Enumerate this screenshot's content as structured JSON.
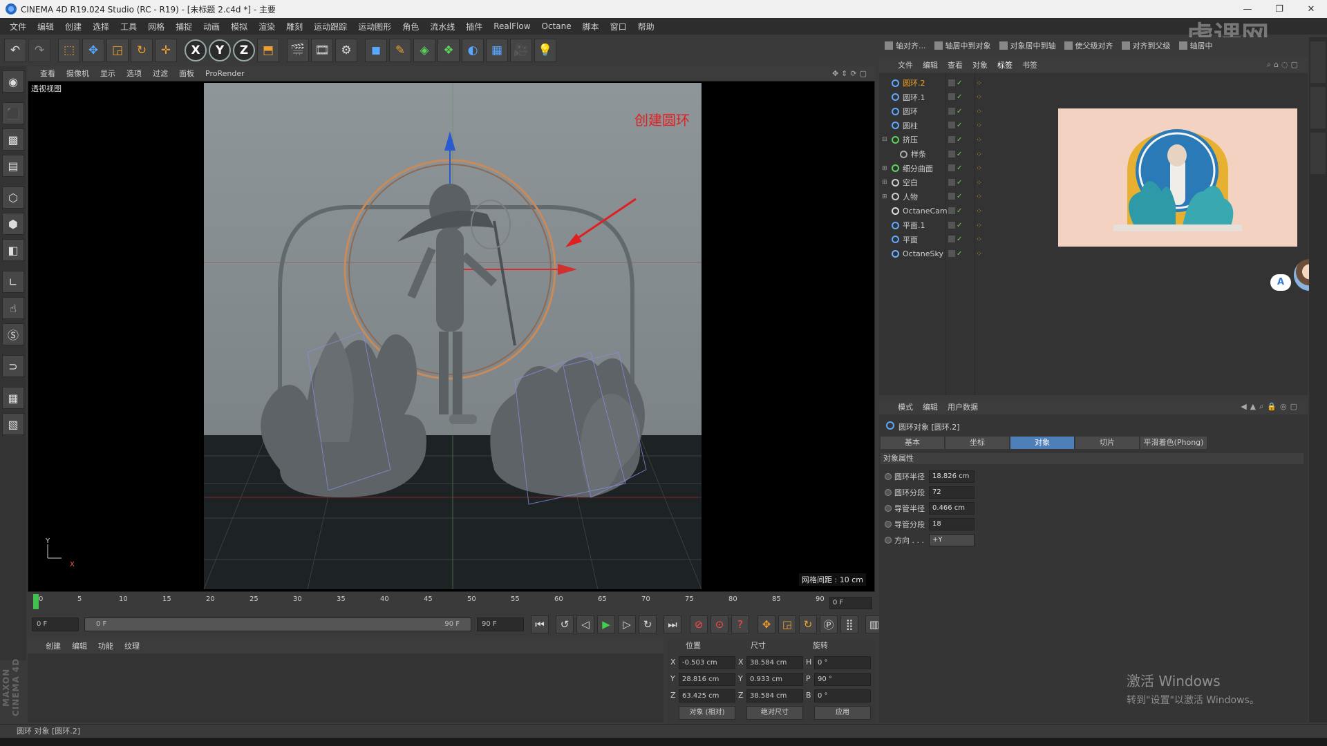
{
  "window": {
    "title": "CINEMA 4D R19.024 Studio (RC - R19) - [未标题 2.c4d *] - 主要",
    "buttons": [
      "—",
      "❐",
      "✕"
    ]
  },
  "menus": [
    "文件",
    "编辑",
    "创建",
    "选择",
    "工具",
    "网格",
    "捕捉",
    "动画",
    "模拟",
    "渲染",
    "雕刻",
    "运动跟踪",
    "运动图形",
    "角色",
    "流水线",
    "插件",
    "RealFlow",
    "Octane",
    "脚本",
    "窗口",
    "帮助"
  ],
  "toolbar": {
    "axis_x": "X",
    "axis_y": "Y",
    "axis_z": "Z"
  },
  "viewport": {
    "menu": [
      "查看",
      "摄像机",
      "显示",
      "选项",
      "过滤",
      "面板",
      "ProRender"
    ],
    "label": "透视视图",
    "grid_spacing": "网格间距 : 10 cm",
    "annotation": "创建圆环",
    "axis_y": "Y",
    "axis_x": "X"
  },
  "timeline": {
    "ticks": [
      "0",
      "5",
      "10",
      "15",
      "20",
      "25",
      "30",
      "35",
      "40",
      "45",
      "50",
      "55",
      "60",
      "65",
      "70",
      "75",
      "80",
      "85",
      "90"
    ],
    "frame_display": "0 F",
    "start_frame": "0 F",
    "range_start": "0 F",
    "range_end": "90 F",
    "end_frame": "90 F"
  },
  "material_manager": {
    "menu": [
      "创建",
      "编辑",
      "功能",
      "纹理"
    ]
  },
  "coordinates": {
    "headers": {
      "position": "位置",
      "size": "尺寸",
      "rotation": "旋转"
    },
    "rows": [
      {
        "axis": "X",
        "pos": "-0.503 cm",
        "size_axis": "X",
        "size": "38.584 cm",
        "rot_axis": "H",
        "rot": "0 °"
      },
      {
        "axis": "Y",
        "pos": "28.816 cm",
        "size_axis": "Y",
        "size": "0.933 cm",
        "rot_axis": "P",
        "rot": "90 °"
      },
      {
        "axis": "Z",
        "pos": "63.425 cm",
        "size_axis": "Z",
        "size": "38.584 cm",
        "rot_axis": "B",
        "rot": "0 °"
      }
    ],
    "mode_object": "对象 (相对)",
    "mode_size": "绝对尺寸",
    "apply": "应用"
  },
  "status_bar": "圆环 对象 [圆环.2]",
  "right_toolbar": [
    "轴对齐...",
    "轴居中到对象",
    "对象居中到轴",
    "使父级对齐",
    "对齐到父级",
    "轴居中"
  ],
  "object_manager": {
    "menu": [
      "文件",
      "编辑",
      "查看",
      "对象",
      "标签",
      "书签"
    ],
    "objects": [
      {
        "name": "圆环.2",
        "selected": true,
        "indent": 0,
        "expander": "",
        "icon_color": "#5fa8ff"
      },
      {
        "name": "圆环.1",
        "selected": false,
        "indent": 0,
        "expander": "",
        "icon_color": "#5fa8ff"
      },
      {
        "name": "圆环",
        "selected": false,
        "indent": 0,
        "expander": "",
        "icon_color": "#5fa8ff"
      },
      {
        "name": "圆柱",
        "selected": false,
        "indent": 0,
        "expander": "",
        "icon_color": "#5fa8ff"
      },
      {
        "name": "挤压",
        "selected": false,
        "indent": 0,
        "expander": "⊟",
        "icon_color": "#5cd35c"
      },
      {
        "name": "样条",
        "selected": false,
        "indent": 1,
        "expander": "",
        "icon_color": "#aaaaaa"
      },
      {
        "name": "细分曲面",
        "selected": false,
        "indent": 0,
        "expander": "⊞",
        "icon_color": "#5cd35c"
      },
      {
        "name": "空白",
        "selected": false,
        "indent": 0,
        "expander": "⊞",
        "icon_color": "#cccccc"
      },
      {
        "name": "人物",
        "selected": false,
        "indent": 0,
        "expander": "⊞",
        "icon_color": "#cccccc"
      },
      {
        "name": "OctaneCam",
        "selected": false,
        "indent": 0,
        "expander": "",
        "icon_color": "#dddddd"
      },
      {
        "name": "平面.1",
        "selected": false,
        "indent": 0,
        "expander": "",
        "icon_color": "#5fa8ff"
      },
      {
        "name": "平面",
        "selected": false,
        "indent": 0,
        "expander": "",
        "icon_color": "#5fa8ff"
      },
      {
        "name": "OctaneSky",
        "selected": false,
        "indent": 0,
        "expander": "",
        "icon_color": "#6fb0ff"
      }
    ]
  },
  "attribute_manager": {
    "menu": [
      "模式",
      "编辑",
      "用户数据"
    ],
    "object_title": "圆环对象 [圆环.2]",
    "tabs": [
      "基本",
      "坐标",
      "对象",
      "切片",
      "平滑着色(Phong)"
    ],
    "active_tab": "对象",
    "section": "对象属性",
    "props": [
      {
        "label": "圆环半径",
        "value": "18.826 cm"
      },
      {
        "label": "圆环分段",
        "value": "72"
      },
      {
        "label": "导管半径",
        "value": "0.466 cm"
      },
      {
        "label": "导管分段",
        "value": "18"
      },
      {
        "label": "方向 . . .",
        "value": "+Y"
      }
    ]
  },
  "assistant_badge": "A",
  "watermark": {
    "line1": "激活 Windows",
    "line2": "转到\"设置\"以激活 Windows。"
  },
  "colors": {
    "accent_blue": "#4f7fb8",
    "selection_orange": "#f0a020",
    "annotation_red": "#e02020",
    "play_green": "#3fd04f"
  }
}
